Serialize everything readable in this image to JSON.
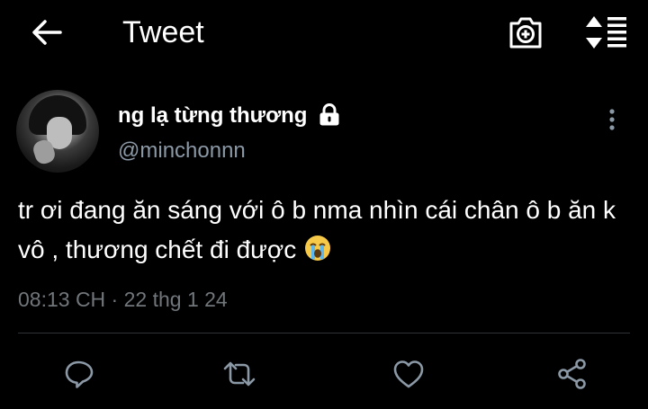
{
  "header": {
    "title": "Tweet",
    "back_icon": "arrow-left-icon",
    "camera_icon": "camera-icon",
    "sort_icon": "sort-icon"
  },
  "author": {
    "display_name": "ng lạ từng thương",
    "handle": "@minchonnn",
    "locked_icon": "lock-icon"
  },
  "tweet": {
    "text": "tr ơi đang ăn sáng với ô b nma nhìn cái chân ô b ăn k vô , thương chết đi được",
    "emoji": "loudly-crying-face",
    "timestamp": "08:13 CH · 22 thg 1 24"
  },
  "actions": {
    "reply_icon": "reply-icon",
    "retweet_icon": "retweet-icon",
    "like_icon": "heart-icon",
    "share_icon": "share-icon"
  },
  "colors": {
    "background": "#000000",
    "text": "#ffffff",
    "handle": "#8b98a5",
    "meta": "#71767b",
    "divider": "#2f3336",
    "icon": "#8b98a5"
  }
}
